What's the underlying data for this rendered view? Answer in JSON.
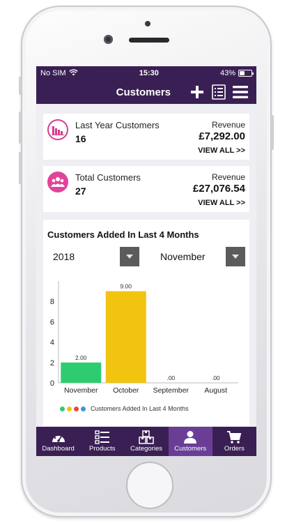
{
  "status": {
    "carrier": "No SIM",
    "time": "15:30",
    "battery": "43%",
    "battery_level": 0.43
  },
  "nav": {
    "title": "Customers",
    "icons": [
      "plus-icon",
      "list-icon",
      "menu-icon"
    ]
  },
  "cards": [
    {
      "label": "Last Year Customers",
      "count": "16",
      "revenue_label": "Revenue",
      "revenue": "£7,292.00",
      "view_all": "VIEW ALL >>",
      "icon": "bar-chart-icon"
    },
    {
      "label": "Total Customers",
      "count": "27",
      "revenue_label": "Revenue",
      "revenue": "£27,076.54",
      "view_all": "VIEW ALL >>",
      "icon": "people-icon"
    }
  ],
  "chart_section": {
    "title": "Customers Added In Last 4 Months",
    "year_select": "2018",
    "month_select": "November"
  },
  "chart_data": {
    "type": "bar",
    "categories": [
      "November",
      "October",
      "September",
      "August"
    ],
    "values": [
      2,
      9,
      0,
      0
    ],
    "data_labels": [
      "2.00",
      "9.00",
      ".00",
      ".00"
    ],
    "colors": [
      "#2ecc71",
      "#f1c40f",
      "#e74c3c",
      "#3498db"
    ],
    "yticks": [
      "0",
      "2",
      "4",
      "6",
      "8"
    ],
    "ylim": [
      0,
      10
    ],
    "legend": "Customers Added In Last 4 Months",
    "legend_position": "bottom",
    "grid": false
  },
  "tabs": [
    {
      "label": "Dashboard",
      "icon": "dashboard-gauge-icon",
      "active": false
    },
    {
      "label": "Products",
      "icon": "product-list-icon",
      "active": false
    },
    {
      "label": "Categories",
      "icon": "boxes-icon",
      "active": false
    },
    {
      "label": "Customers",
      "icon": "customer-icon",
      "active": true
    },
    {
      "label": "Orders",
      "icon": "cart-icon",
      "active": false
    }
  ]
}
